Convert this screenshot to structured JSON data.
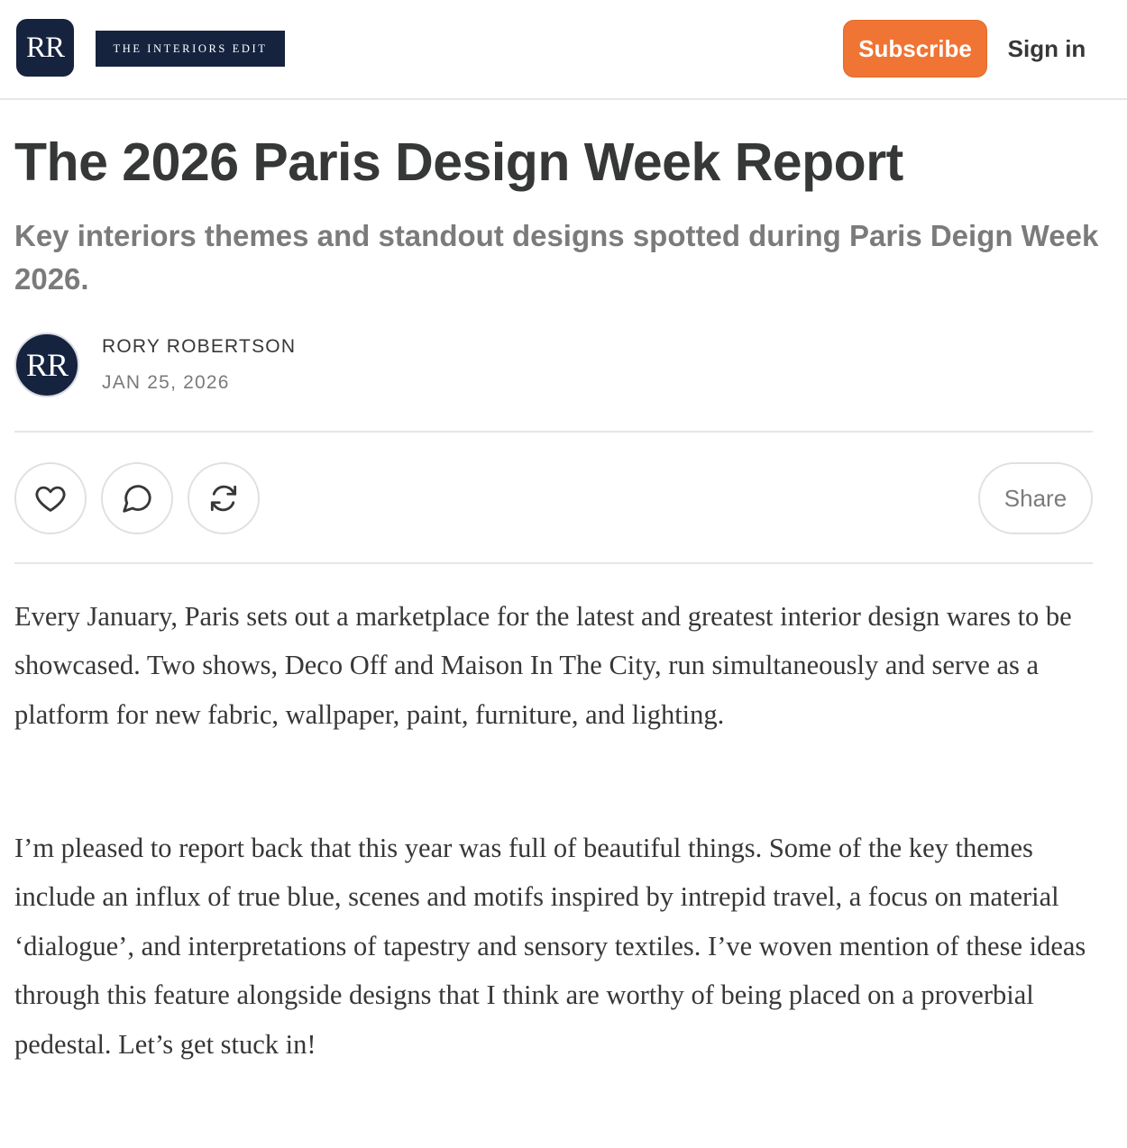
{
  "header": {
    "logo_initials": "RR",
    "publication_name": "THE INTERIORS EDIT",
    "subscribe_label": "Subscribe",
    "signin_label": "Sign in",
    "accent_color": "#f07433",
    "brand_color": "#16233f"
  },
  "post": {
    "title": "The 2026 Paris Design Week Report",
    "subtitle": "Key interiors themes and standout designs spotted during Paris Deign Week 2026.",
    "author_initials": "RR",
    "author": "RORY ROBERTSON",
    "date": "JAN 25, 2026"
  },
  "actions": {
    "like_icon": "heart-icon",
    "comment_icon": "speech-bubble-icon",
    "restack_icon": "refresh-icon",
    "share_label": "Share"
  },
  "body": {
    "paragraphs": [
      "Every January, Paris sets out a marketplace for the latest and greatest interior design wares to be showcased. Two shows, Deco Off and Maison In The City, run simultaneously and serve as a platform for new fabric, wallpaper, paint, furniture, and lighting.",
      "I’m pleased to report back that this year was full of beautiful things. Some of the key themes include an influx of true blue, scenes and motifs inspired by intrepid travel, a focus on material ‘dialogue’, and interpretations of tapestry and sensory textiles. I’ve woven mention of these ideas through this feature alongside designs that I think are worthy of being placed on a proverbial pedestal. Let’s get stuck in!"
    ]
  }
}
